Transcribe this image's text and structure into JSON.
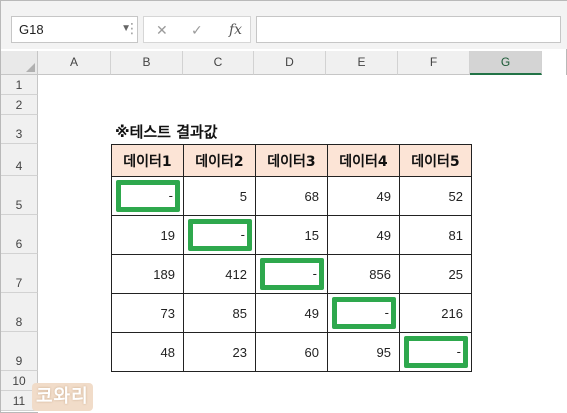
{
  "name_box": {
    "value": "G18"
  },
  "formula_bar": {
    "fx_label": "fx",
    "value": ""
  },
  "columns": [
    "A",
    "B",
    "C",
    "D",
    "E",
    "F",
    "G"
  ],
  "selected_column": "G",
  "rows": [
    "1",
    "2",
    "3",
    "4",
    "5",
    "6",
    "7",
    "8",
    "9",
    "10",
    "11"
  ],
  "sheet": {
    "title": "※테스트 결과값",
    "headers": [
      "데이터1",
      "데이터2",
      "데이터3",
      "데이터4",
      "데이터5"
    ],
    "rows": [
      [
        "-",
        "5",
        "68",
        "49",
        "52"
      ],
      [
        "19",
        "-",
        "15",
        "49",
        "81"
      ],
      [
        "189",
        "412",
        "-",
        "856",
        "25"
      ],
      [
        "73",
        "85",
        "49",
        "-",
        "216"
      ],
      [
        "48",
        "23",
        "60",
        "95",
        "-"
      ]
    ]
  },
  "watermark": "코와리",
  "colors": {
    "header_fill": "#fce4d6",
    "highlight": "#2ea84d",
    "excel_green": "#217346"
  }
}
